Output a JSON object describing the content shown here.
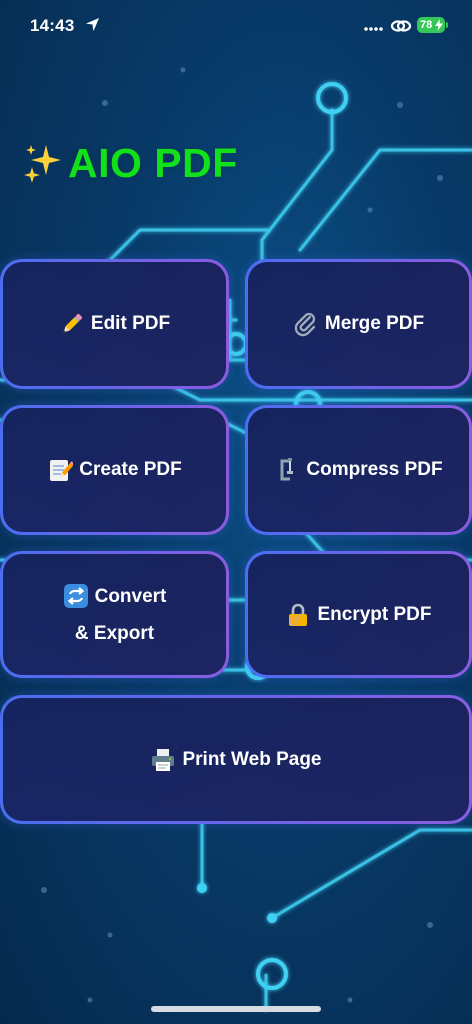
{
  "status_bar": {
    "time": "14:43",
    "battery_level": "78"
  },
  "app": {
    "title": "AIO PDF"
  },
  "tools": {
    "edit_pdf": "Edit PDF",
    "merge_pdf": "Merge PDF",
    "create_pdf": "Create PDF",
    "compress_pdf": "Compress PDF",
    "convert_line1": "Convert",
    "convert_line2": "& Export",
    "encrypt_pdf": "Encrypt PDF",
    "print_web_page": "Print Web Page"
  },
  "colors": {
    "title_green": "#12e01a",
    "tile_border_start": "#4a6ef2",
    "tile_border_end": "#8a5ce0",
    "background": "#083a68",
    "circuit": "#3fd0f2",
    "battery_green": "#34c759"
  },
  "icons": {
    "title": "sparkles-icon",
    "edit_pdf": "pencil-icon",
    "merge_pdf": "paperclip-icon",
    "create_pdf": "memo-icon",
    "compress_pdf": "clamp-icon",
    "convert_export": "repeat-arrows-icon",
    "encrypt_pdf": "locked-with-key-icon",
    "print_web_page": "printer-icon"
  }
}
